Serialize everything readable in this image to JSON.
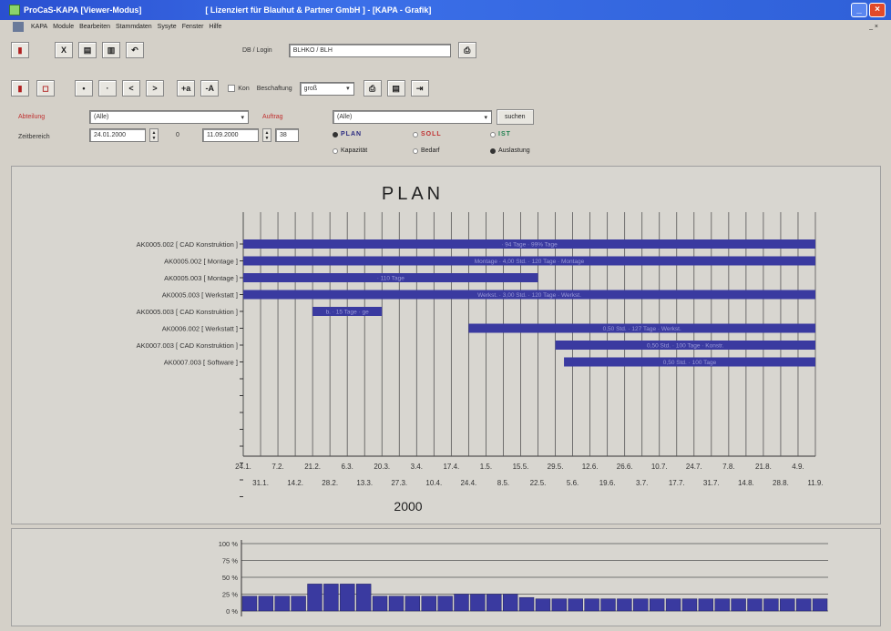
{
  "window": {
    "app_title": "ProCaS-KAPA [Viewer-Modus]",
    "license_title": "[ Lizenziert für Blauhut & Partner GmbH ] - [KAPA - Grafik]",
    "btn_min": "_",
    "btn_max": "□",
    "btn_close": "×"
  },
  "menu": [
    "KAPA",
    "Module",
    "Bearbeiten",
    "Stammdaten",
    "Sysyte",
    "Fenster",
    "Hilfe"
  ],
  "menu_right": "_ ×",
  "toolbar1": {
    "btn_x": "X",
    "btn_b1": "▤",
    "btn_b2": "▥",
    "btn_undo": "↶",
    "db_label": "DB / Login",
    "db_value": "BLHKO / BLH",
    "btn_print": "⎙"
  },
  "toolbar2": {
    "btn_dot1": "•",
    "btn_dot2": "·",
    "btn_prev": "<",
    "btn_next": ">",
    "btn_plus": "+a",
    "btn_minus": "-A",
    "chk_label": "Kon",
    "beschaftung_label": "Beschaftung",
    "size_value": "groß",
    "size_arrow": "▾"
  },
  "filters": {
    "abteilung_label": "Abteilung",
    "abteilung_value": "(Alle)",
    "auftrag_label": "Auftrag",
    "auftrag_value": "(Alle)",
    "zeitbereich_label": "Zeitbereich",
    "date_from": "24.01.2000",
    "date_from_days": "0",
    "date_to": "11.09.2000",
    "date_to_days": "38",
    "search_label": "suchen",
    "dropdown_arrow": "▾",
    "spin_up": "▲",
    "spin_down": "▼",
    "radio_plan": "PLAN",
    "radio_soll": "SOLL",
    "radio_ist": "IST",
    "radio_kapazitat": "Kapazität",
    "radio_bedarf": "Bedarf",
    "radio_auslastung": "Auslastung"
  },
  "chart_data": [
    {
      "type": "gantt",
      "title": "PLAN",
      "xlabel": "2000",
      "ticks_top": [
        "24.1.",
        "7.2.",
        "21.2.",
        "6.3.",
        "20.3.",
        "3.4.",
        "17.4.",
        "1.5.",
        "15.5.",
        "29.5.",
        "12.6.",
        "26.6.",
        "10.7.",
        "24.7.",
        "7.8.",
        "21.8.",
        "4.9."
      ],
      "ticks_bottom": [
        "31.1.",
        "14.2.",
        "28.2.",
        "13.3.",
        "27.3.",
        "10.4.",
        "24.4.",
        "8.5.",
        "22.5.",
        "5.6.",
        "19.6.",
        "3.7.",
        "17.7.",
        "31.7.",
        "14.8.",
        "28.8.",
        "11.9."
      ],
      "tasks": [
        {
          "label": "AK0005.002 [ CAD Konstruktion ]",
          "start": 0,
          "end": 33,
          "bar_label": "· 94 Tage · 99% Tage"
        },
        {
          "label": "AK0005.002 [ Montage ]",
          "start": 0,
          "end": 33,
          "bar_label": "Montage · 4,00 Std. · 120 Tage · Montage"
        },
        {
          "label": "AK0005.003 [ Montage ]",
          "start": 0,
          "end": 17,
          "bar_label": "· 110 Tage"
        },
        {
          "label": "AK0005.003 [ Werkstatt ]",
          "start": 0,
          "end": 33,
          "bar_label": "Werkst. · 3,00 Std. · 120 Tage · Werkst."
        },
        {
          "label": "AK0005.003 [ CAD Konstruktion ]",
          "start": 4,
          "end": 8,
          "bar_label": "b. · 15 Tage · ge"
        },
        {
          "label": "AK0006.002 [ Werkstatt ]",
          "start": 13,
          "end": 33,
          "bar_label": "0,50 Std. · 127 Tage · Werkst."
        },
        {
          "label": "AK0007.003 [ CAD Konstruktion ]",
          "start": 18,
          "end": 33,
          "bar_label": "0,50 Std. · 100 Tage · Konstr."
        },
        {
          "label": "AK0007.003 [ Software ]",
          "start": 18.5,
          "end": 33,
          "bar_label": "0,50 Std. · 100 Tage"
        }
      ],
      "bar_color": "#3a3aa0"
    },
    {
      "type": "bar",
      "ylabels": [
        "100 %",
        "75 %",
        "50 %",
        "25 %",
        "0 %"
      ],
      "ylim": [
        0,
        100
      ],
      "values": [
        22,
        22,
        22,
        22,
        40,
        40,
        40,
        40,
        22,
        22,
        22,
        22,
        22,
        25,
        25,
        25,
        25,
        20,
        18,
        18,
        18,
        18,
        18,
        18,
        18,
        18,
        18,
        18,
        18,
        18,
        18,
        18,
        18,
        18,
        18,
        18
      ],
      "bar_color": "#3a3aa0"
    }
  ]
}
